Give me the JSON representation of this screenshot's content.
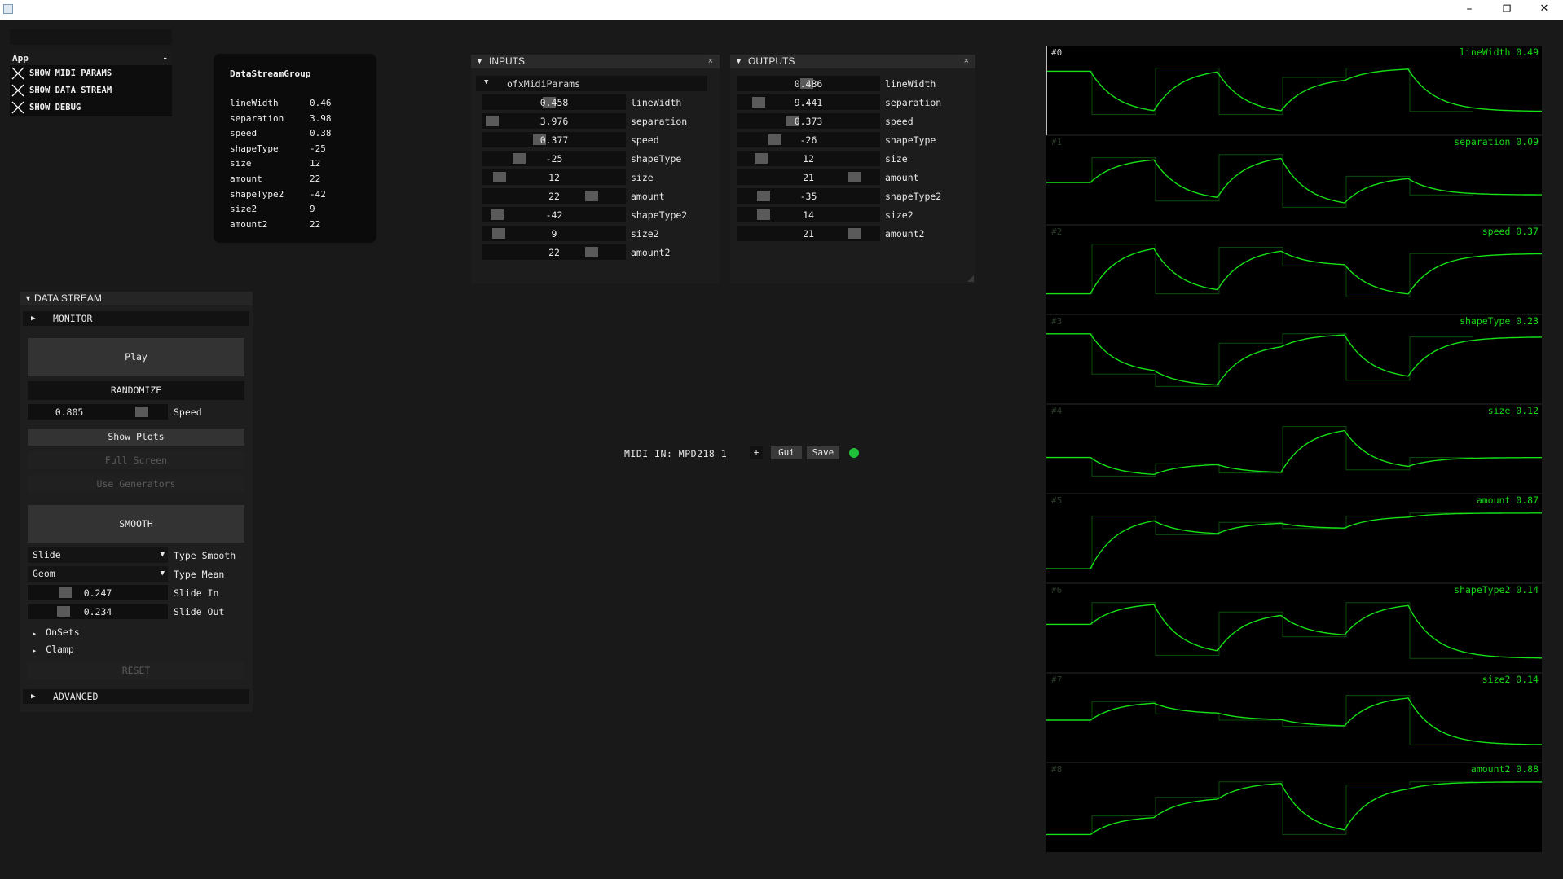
{
  "window": {
    "minimize": "–",
    "restore": "❐",
    "close": "✕"
  },
  "app_panel": {
    "header": "App",
    "collapse": "-",
    "items": [
      {
        "label": "SHOW MIDI PARAMS"
      },
      {
        "label": "SHOW DATA STREAM"
      },
      {
        "label": "SHOW DEBUG"
      }
    ]
  },
  "stream_group": {
    "title": "DataStreamGroup",
    "rows": [
      {
        "name": "lineWidth",
        "value": "0.46"
      },
      {
        "name": "separation",
        "value": "3.98"
      },
      {
        "name": "speed",
        "value": "0.38"
      },
      {
        "name": "shapeType",
        "value": "-25"
      },
      {
        "name": "size",
        "value": "12"
      },
      {
        "name": "amount",
        "value": "22"
      },
      {
        "name": "shapeType2",
        "value": "-42"
      },
      {
        "name": "size2",
        "value": "9"
      },
      {
        "name": "amount2",
        "value": "22"
      }
    ]
  },
  "inputs": {
    "title": "INPUTS",
    "close": "×",
    "group": "ofxMidiParams",
    "sliders": [
      {
        "label": "lineWidth",
        "value": "0.458",
        "frac": 0.46
      },
      {
        "label": "separation",
        "value": "3.976",
        "frac": 0.0
      },
      {
        "label": "speed",
        "value": "0.377",
        "frac": 0.38
      },
      {
        "label": "shapeType",
        "value": "-25",
        "frac": 0.22
      },
      {
        "label": "size",
        "value": "12",
        "frac": 0.06
      },
      {
        "label": "amount",
        "value": "22",
        "frac": 0.8
      },
      {
        "label": "shapeType2",
        "value": "-42",
        "frac": 0.04
      },
      {
        "label": "size2",
        "value": "9",
        "frac": 0.05
      },
      {
        "label": "amount2",
        "value": "22",
        "frac": 0.8
      }
    ]
  },
  "outputs": {
    "title": "OUTPUTS",
    "close": "×",
    "sliders": [
      {
        "label": "lineWidth",
        "value": "0.486",
        "frac": 0.49
      },
      {
        "label": "separation",
        "value": "9.441",
        "frac": 0.1
      },
      {
        "label": "speed",
        "value": "0.373",
        "frac": 0.37
      },
      {
        "label": "shapeType",
        "value": "-26",
        "frac": 0.23
      },
      {
        "label": "size",
        "value": "12",
        "frac": 0.12
      },
      {
        "label": "amount",
        "value": "21",
        "frac": 0.87
      },
      {
        "label": "shapeType2",
        "value": "-35",
        "frac": 0.14
      },
      {
        "label": "size2",
        "value": "14",
        "frac": 0.14
      },
      {
        "label": "amount2",
        "value": "21",
        "frac": 0.87
      }
    ]
  },
  "data_stream": {
    "title": "DATA STREAM",
    "monitor": "MONITOR",
    "play": "Play",
    "randomize": "RANDOMIZE",
    "speed": {
      "value": "0.805",
      "label": "Speed",
      "frac": 0.8
    },
    "show_plots": "Show Plots",
    "full_screen": "Full Screen",
    "use_generators": "Use Generators",
    "smooth": "SMOOTH",
    "type_smooth": {
      "value": "Slide",
      "label": "Type Smooth"
    },
    "type_mean": {
      "value": "Geom",
      "label": "Type Mean"
    },
    "slide_in": {
      "value": "0.247",
      "label": "Slide In",
      "frac": 0.25
    },
    "slide_out": {
      "value": "0.234",
      "label": "Slide Out",
      "frac": 0.23
    },
    "onsets": "OnSets",
    "clamp": "Clamp",
    "reset": "RESET",
    "advanced": "ADVANCED"
  },
  "midi": {
    "label": "MIDI IN: MPD218 1",
    "plus": "+",
    "gui": "Gui",
    "save": "Save",
    "status_color": "#22c03a"
  },
  "plots": [
    {
      "index": "#0",
      "label": "lineWidth 0.49",
      "value": 0.49
    },
    {
      "index": "#1",
      "label": "separation 0.09",
      "value": 0.09
    },
    {
      "index": "#2",
      "label": "speed 0.37",
      "value": 0.37
    },
    {
      "index": "#3",
      "label": "shapeType 0.23",
      "value": 0.23
    },
    {
      "index": "#4",
      "label": "size 0.12",
      "value": 0.12
    },
    {
      "index": "#5",
      "label": "amount 0.87",
      "value": 0.87
    },
    {
      "index": "#6",
      "label": "shapeType2 0.14",
      "value": 0.14
    },
    {
      "index": "#7",
      "label": "size2 0.14",
      "value": 0.14
    },
    {
      "index": "#8",
      "label": "amount2 0.88",
      "value": 0.88
    }
  ],
  "colors": {
    "plot_line": "#16e016",
    "plot_step": "#0d4d0d",
    "panel_bg": "#1c1c1c",
    "accent_green": "#22c03a"
  }
}
